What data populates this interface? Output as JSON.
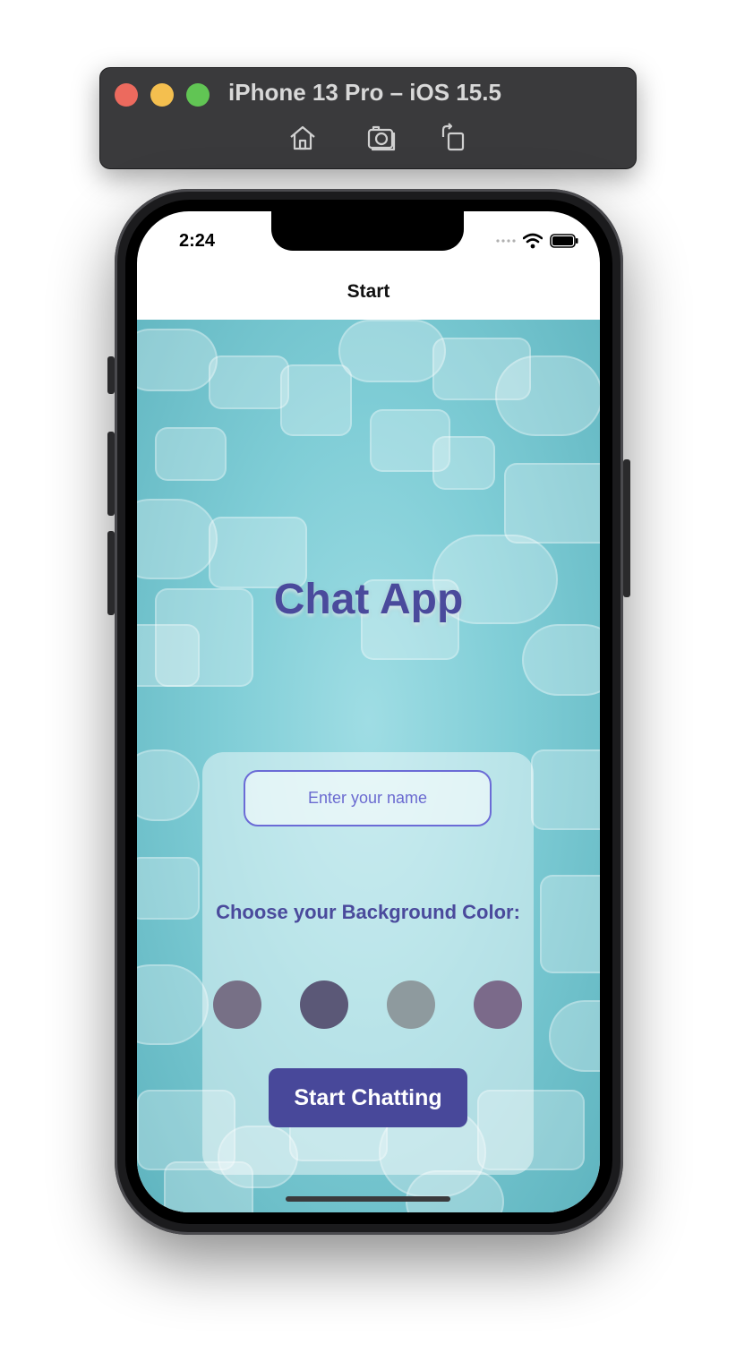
{
  "simulator": {
    "title": "iPhone 13 Pro – iOS 15.5",
    "buttons": [
      "home-icon",
      "screenshot-icon",
      "rotate-icon"
    ]
  },
  "status_bar": {
    "time": "2:24",
    "signal_icon": "signal-dots-icon",
    "wifi_icon": "wifi-icon",
    "battery_icon": "battery-icon"
  },
  "nav": {
    "title": "Start"
  },
  "main": {
    "app_title": "Chat App",
    "name_input": {
      "placeholder": "Enter your name",
      "value": ""
    },
    "color_label": "Choose your Background Color:",
    "colors": [
      "#777086",
      "#5b5877",
      "#8e9a9e",
      "#7b6a8a"
    ],
    "start_button_label": "Start Chatting"
  },
  "colors": {
    "accent": "#4a4a9c",
    "button": "#48489a",
    "input_border": "#6b6bd6"
  }
}
